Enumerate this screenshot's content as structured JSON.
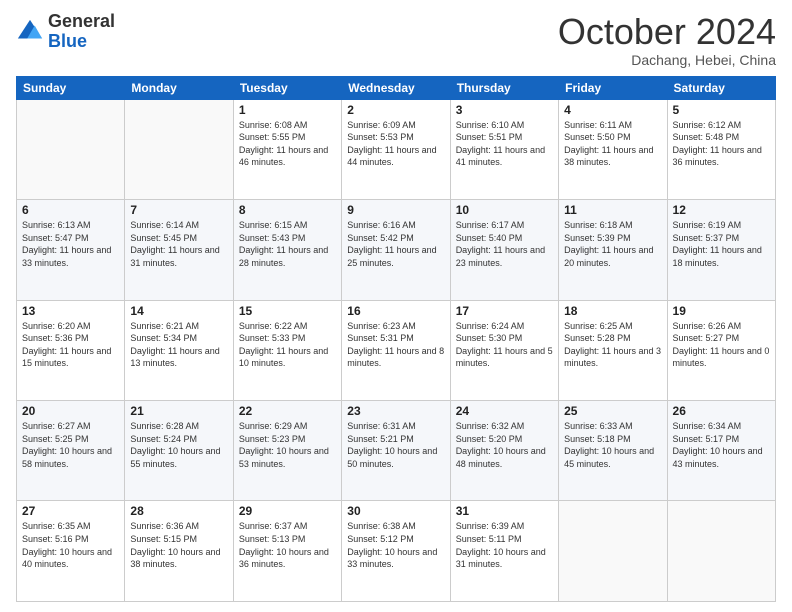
{
  "logo": {
    "general": "General",
    "blue": "Blue"
  },
  "header": {
    "month": "October 2024",
    "location": "Dachang, Hebei, China"
  },
  "weekdays": [
    "Sunday",
    "Monday",
    "Tuesday",
    "Wednesday",
    "Thursday",
    "Friday",
    "Saturday"
  ],
  "weeks": [
    [
      {
        "day": "",
        "info": ""
      },
      {
        "day": "",
        "info": ""
      },
      {
        "day": "1",
        "info": "Sunrise: 6:08 AM\nSunset: 5:55 PM\nDaylight: 11 hours and 46 minutes."
      },
      {
        "day": "2",
        "info": "Sunrise: 6:09 AM\nSunset: 5:53 PM\nDaylight: 11 hours and 44 minutes."
      },
      {
        "day": "3",
        "info": "Sunrise: 6:10 AM\nSunset: 5:51 PM\nDaylight: 11 hours and 41 minutes."
      },
      {
        "day": "4",
        "info": "Sunrise: 6:11 AM\nSunset: 5:50 PM\nDaylight: 11 hours and 38 minutes."
      },
      {
        "day": "5",
        "info": "Sunrise: 6:12 AM\nSunset: 5:48 PM\nDaylight: 11 hours and 36 minutes."
      }
    ],
    [
      {
        "day": "6",
        "info": "Sunrise: 6:13 AM\nSunset: 5:47 PM\nDaylight: 11 hours and 33 minutes."
      },
      {
        "day": "7",
        "info": "Sunrise: 6:14 AM\nSunset: 5:45 PM\nDaylight: 11 hours and 31 minutes."
      },
      {
        "day": "8",
        "info": "Sunrise: 6:15 AM\nSunset: 5:43 PM\nDaylight: 11 hours and 28 minutes."
      },
      {
        "day": "9",
        "info": "Sunrise: 6:16 AM\nSunset: 5:42 PM\nDaylight: 11 hours and 25 minutes."
      },
      {
        "day": "10",
        "info": "Sunrise: 6:17 AM\nSunset: 5:40 PM\nDaylight: 11 hours and 23 minutes."
      },
      {
        "day": "11",
        "info": "Sunrise: 6:18 AM\nSunset: 5:39 PM\nDaylight: 11 hours and 20 minutes."
      },
      {
        "day": "12",
        "info": "Sunrise: 6:19 AM\nSunset: 5:37 PM\nDaylight: 11 hours and 18 minutes."
      }
    ],
    [
      {
        "day": "13",
        "info": "Sunrise: 6:20 AM\nSunset: 5:36 PM\nDaylight: 11 hours and 15 minutes."
      },
      {
        "day": "14",
        "info": "Sunrise: 6:21 AM\nSunset: 5:34 PM\nDaylight: 11 hours and 13 minutes."
      },
      {
        "day": "15",
        "info": "Sunrise: 6:22 AM\nSunset: 5:33 PM\nDaylight: 11 hours and 10 minutes."
      },
      {
        "day": "16",
        "info": "Sunrise: 6:23 AM\nSunset: 5:31 PM\nDaylight: 11 hours and 8 minutes."
      },
      {
        "day": "17",
        "info": "Sunrise: 6:24 AM\nSunset: 5:30 PM\nDaylight: 11 hours and 5 minutes."
      },
      {
        "day": "18",
        "info": "Sunrise: 6:25 AM\nSunset: 5:28 PM\nDaylight: 11 hours and 3 minutes."
      },
      {
        "day": "19",
        "info": "Sunrise: 6:26 AM\nSunset: 5:27 PM\nDaylight: 11 hours and 0 minutes."
      }
    ],
    [
      {
        "day": "20",
        "info": "Sunrise: 6:27 AM\nSunset: 5:25 PM\nDaylight: 10 hours and 58 minutes."
      },
      {
        "day": "21",
        "info": "Sunrise: 6:28 AM\nSunset: 5:24 PM\nDaylight: 10 hours and 55 minutes."
      },
      {
        "day": "22",
        "info": "Sunrise: 6:29 AM\nSunset: 5:23 PM\nDaylight: 10 hours and 53 minutes."
      },
      {
        "day": "23",
        "info": "Sunrise: 6:31 AM\nSunset: 5:21 PM\nDaylight: 10 hours and 50 minutes."
      },
      {
        "day": "24",
        "info": "Sunrise: 6:32 AM\nSunset: 5:20 PM\nDaylight: 10 hours and 48 minutes."
      },
      {
        "day": "25",
        "info": "Sunrise: 6:33 AM\nSunset: 5:18 PM\nDaylight: 10 hours and 45 minutes."
      },
      {
        "day": "26",
        "info": "Sunrise: 6:34 AM\nSunset: 5:17 PM\nDaylight: 10 hours and 43 minutes."
      }
    ],
    [
      {
        "day": "27",
        "info": "Sunrise: 6:35 AM\nSunset: 5:16 PM\nDaylight: 10 hours and 40 minutes."
      },
      {
        "day": "28",
        "info": "Sunrise: 6:36 AM\nSunset: 5:15 PM\nDaylight: 10 hours and 38 minutes."
      },
      {
        "day": "29",
        "info": "Sunrise: 6:37 AM\nSunset: 5:13 PM\nDaylight: 10 hours and 36 minutes."
      },
      {
        "day": "30",
        "info": "Sunrise: 6:38 AM\nSunset: 5:12 PM\nDaylight: 10 hours and 33 minutes."
      },
      {
        "day": "31",
        "info": "Sunrise: 6:39 AM\nSunset: 5:11 PM\nDaylight: 10 hours and 31 minutes."
      },
      {
        "day": "",
        "info": ""
      },
      {
        "day": "",
        "info": ""
      }
    ]
  ]
}
